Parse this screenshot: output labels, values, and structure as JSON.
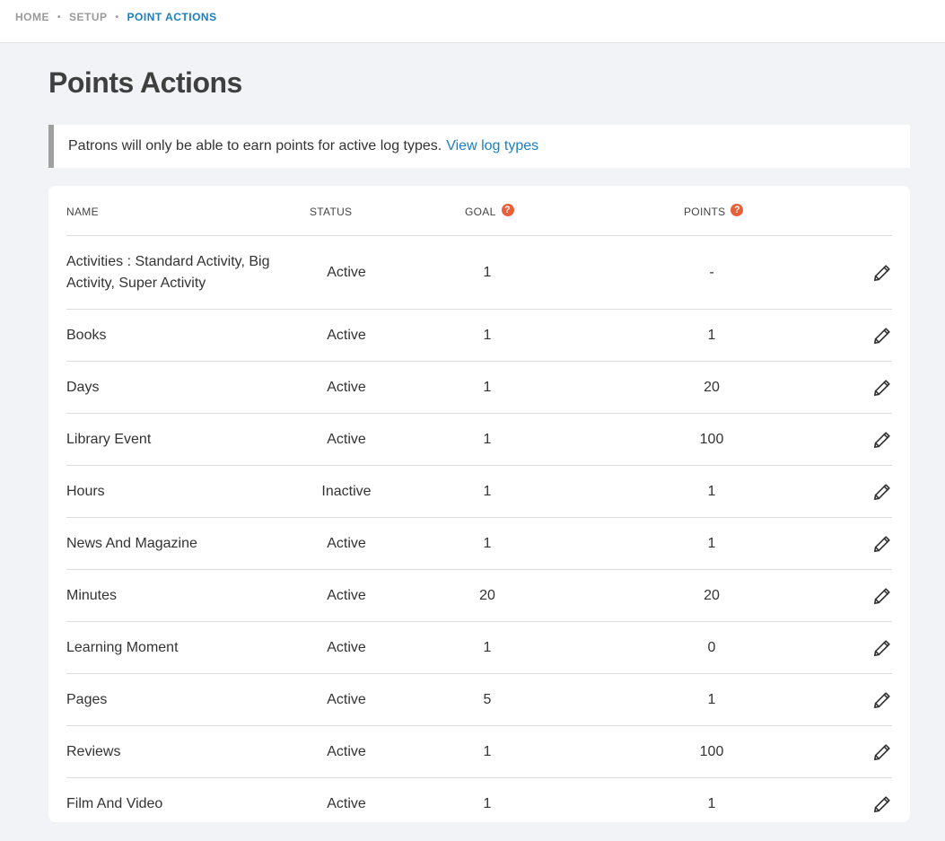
{
  "breadcrumb": {
    "home": "HOME",
    "setup": "SETUP",
    "current": "POINT ACTIONS"
  },
  "page": {
    "title": "Points Actions"
  },
  "notice": {
    "text": "Patrons will only be able to earn points for active log types.",
    "link": "View log types"
  },
  "table": {
    "headers": {
      "name": "NAME",
      "status": "STATUS",
      "goal": "GOAL",
      "points": "POINTS"
    },
    "rows": [
      {
        "name": "Activities : Standard Activity, Big Activity, Super Activity",
        "status": "Active",
        "goal": "1",
        "points": "-"
      },
      {
        "name": "Books",
        "status": "Active",
        "goal": "1",
        "points": "1"
      },
      {
        "name": "Days",
        "status": "Active",
        "goal": "1",
        "points": "20"
      },
      {
        "name": "Library Event",
        "status": "Active",
        "goal": "1",
        "points": "100"
      },
      {
        "name": "Hours",
        "status": "Inactive",
        "goal": "1",
        "points": "1"
      },
      {
        "name": "News And Magazine",
        "status": "Active",
        "goal": "1",
        "points": "1"
      },
      {
        "name": "Minutes",
        "status": "Active",
        "goal": "20",
        "points": "20"
      },
      {
        "name": "Learning Moment",
        "status": "Active",
        "goal": "1",
        "points": "0"
      },
      {
        "name": "Pages",
        "status": "Active",
        "goal": "5",
        "points": "1"
      },
      {
        "name": "Reviews",
        "status": "Active",
        "goal": "1",
        "points": "100"
      },
      {
        "name": "Film And Video",
        "status": "Active",
        "goal": "1",
        "points": "1"
      }
    ]
  },
  "icons": {
    "help": "question-circle-icon",
    "edit": "pencil-icon"
  },
  "colors": {
    "link": "#1a7fc1",
    "help": "#e8603a",
    "background": "#f2f3f7"
  }
}
